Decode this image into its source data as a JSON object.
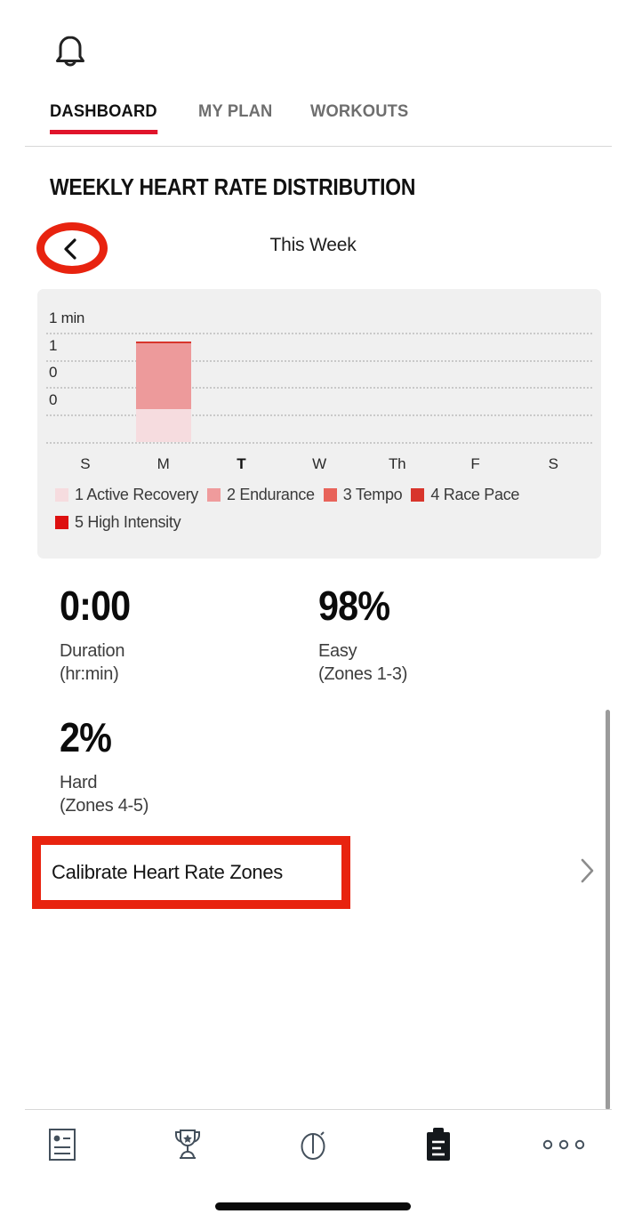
{
  "header": {
    "bell_icon": "bell-icon"
  },
  "tabs": [
    {
      "label": "DASHBOARD",
      "active": true
    },
    {
      "label": "MY PLAN",
      "active": false
    },
    {
      "label": "WORKOUTS",
      "active": false
    }
  ],
  "section": {
    "title": "WEEKLY HEART RATE DISTRIBUTION"
  },
  "week_nav": {
    "back_icon": "chevron-left-icon",
    "label": "This Week",
    "annotation_color": "#e8230f"
  },
  "chart_data": {
    "type": "bar",
    "stacked": true,
    "title": "WEEKLY HEART RATE DISTRIBUTION",
    "subtitle": "This Week",
    "xlabel": "",
    "ylabel": "",
    "unit": "min",
    "grid": true,
    "legend_position": "bottom",
    "categories": [
      "S",
      "M",
      "T",
      "W",
      "Th",
      "F",
      "S"
    ],
    "today": "T",
    "yticks": [
      "1 min",
      "1",
      "0",
      "0"
    ],
    "ytick_values": [
      1.0,
      0.75,
      0.5,
      0.25
    ],
    "ylim": [
      0,
      1.25
    ],
    "series": [
      {
        "name": "1 Active Recovery",
        "color": "#f6dcdf",
        "values": [
          0,
          0.3,
          0,
          0,
          0,
          0,
          0
        ]
      },
      {
        "name": "2 Endurance",
        "color": "#ed9a9b",
        "values": [
          0,
          0.6,
          0,
          0,
          0,
          0,
          0
        ]
      },
      {
        "name": "3 Tempo",
        "color": "#e8635a",
        "values": [
          0,
          0,
          0,
          0,
          0,
          0,
          0
        ]
      },
      {
        "name": "4 Race Pace",
        "color": "#d8352c",
        "values": [
          0,
          0.02,
          0,
          0,
          0,
          0,
          0
        ]
      },
      {
        "name": "5 High Intensity",
        "color": "#dd1010",
        "values": [
          0,
          0,
          0,
          0,
          0,
          0,
          0
        ]
      }
    ],
    "legend": [
      {
        "label": "1 Active Recovery",
        "color": "#f6dcdf"
      },
      {
        "label": "2 Endurance",
        "color": "#ef9b9c"
      },
      {
        "label": "3 Tempo",
        "color": "#e8635a"
      },
      {
        "label": "4 Race Pace",
        "color": "#d8352c"
      },
      {
        "label": "5 High Intensity",
        "color": "#dd1010"
      }
    ]
  },
  "stats": [
    {
      "value": "0:00",
      "label": "Duration",
      "sub": "(hr:min)"
    },
    {
      "value": "98%",
      "label": "Easy",
      "sub": "(Zones 1-3)"
    },
    {
      "value": "2%",
      "label": "Hard",
      "sub": "(Zones 4-5)"
    }
  ],
  "calibrate": {
    "label": "Calibrate Heart Rate Zones",
    "chevron_icon": "chevron-right-icon",
    "highlight_color": "#e8230f"
  },
  "bottom_nav": [
    {
      "icon": "profile-card-icon",
      "active": false
    },
    {
      "icon": "trophy-icon",
      "active": false
    },
    {
      "icon": "stopwatch-icon",
      "active": false
    },
    {
      "icon": "clipboard-icon",
      "active": true
    },
    {
      "icon": "more-dots-icon",
      "active": false
    }
  ]
}
